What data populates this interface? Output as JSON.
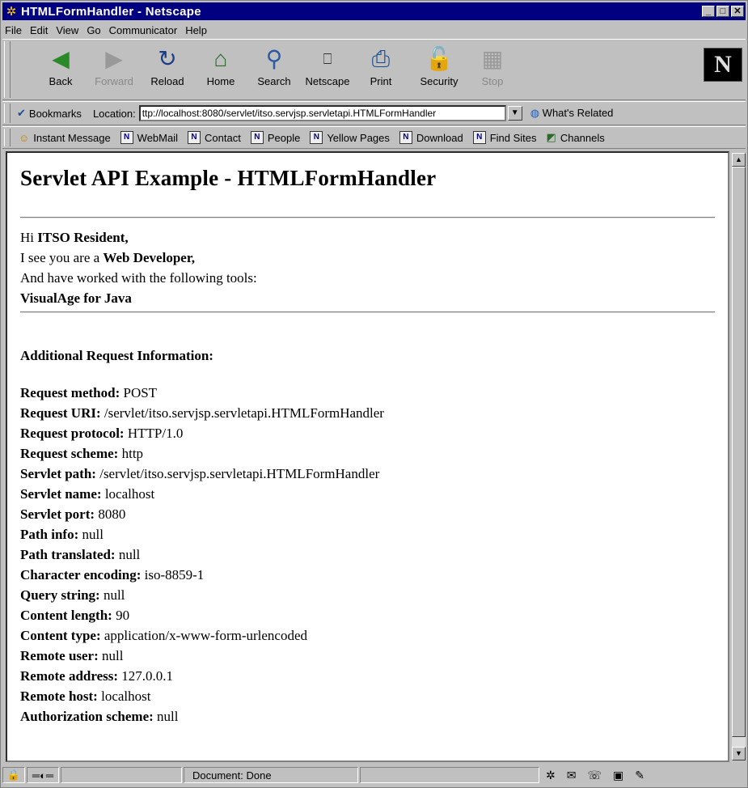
{
  "window": {
    "title": "HTMLFormHandler - Netscape"
  },
  "menu": [
    "File",
    "Edit",
    "View",
    "Go",
    "Communicator",
    "Help"
  ],
  "nav_buttons": [
    {
      "label": "Back",
      "icon": "back-icon",
      "enabled": true
    },
    {
      "label": "Forward",
      "icon": "forward-icon",
      "enabled": false
    },
    {
      "label": "Reload",
      "icon": "reload-icon",
      "enabled": true
    },
    {
      "label": "Home",
      "icon": "home-icon",
      "enabled": true
    },
    {
      "label": "Search",
      "icon": "search-icon",
      "enabled": true
    },
    {
      "label": "Netscape",
      "icon": "netscape-icon",
      "enabled": true
    },
    {
      "label": "Print",
      "icon": "print-icon",
      "enabled": true
    },
    {
      "label": "Security",
      "icon": "security-icon",
      "enabled": true
    },
    {
      "label": "Stop",
      "icon": "stop-icon",
      "enabled": false
    }
  ],
  "location": {
    "bookmarks": "Bookmarks",
    "label": "Location:",
    "url": "ttp://localhost:8080/servlet/itso.servjsp.servletapi.HTMLFormHandler",
    "whats_related": "What's Related"
  },
  "personal": [
    "Instant Message",
    "WebMail",
    "Contact",
    "People",
    "Yellow Pages",
    "Download",
    "Find Sites",
    "Channels"
  ],
  "page": {
    "heading": "Servlet API Example - HTMLFormHandler",
    "greet": {
      "hi": "Hi ",
      "name": "ITSO Resident,",
      "see": "I see you are a ",
      "role": "Web Developer,",
      "tools_text": "And have worked with the following tools:",
      "tool": "VisualAge for Java"
    },
    "additional": "Additional Request Information:",
    "requests": [
      {
        "label": "Request method:",
        "value": "POST"
      },
      {
        "label": "Request URI:",
        "value": "/servlet/itso.servjsp.servletapi.HTMLFormHandler"
      },
      {
        "label": "Request protocol:",
        "value": "HTTP/1.0"
      },
      {
        "label": "Request scheme:",
        "value": "http"
      },
      {
        "label": "Servlet path:",
        "value": "/servlet/itso.servjsp.servletapi.HTMLFormHandler"
      },
      {
        "label": "Servlet name:",
        "value": "localhost"
      },
      {
        "label": "Servlet port:",
        "value": "8080"
      },
      {
        "label": "Path info:",
        "value": "null"
      },
      {
        "label": "Path translated:",
        "value": "null"
      },
      {
        "label": "Character encoding:",
        "value": "iso-8859-1"
      },
      {
        "label": "Query string:",
        "value": "null"
      },
      {
        "label": "Content length:",
        "value": "90"
      },
      {
        "label": "Content type:",
        "value": "application/x-www-form-urlencoded"
      },
      {
        "label": "Remote user:",
        "value": "null"
      },
      {
        "label": "Remote address:",
        "value": "127.0.0.1"
      },
      {
        "label": "Remote host:",
        "value": "localhost"
      },
      {
        "label": "Authorization scheme:",
        "value": "null"
      }
    ]
  },
  "status": {
    "text": "Document: Done"
  }
}
